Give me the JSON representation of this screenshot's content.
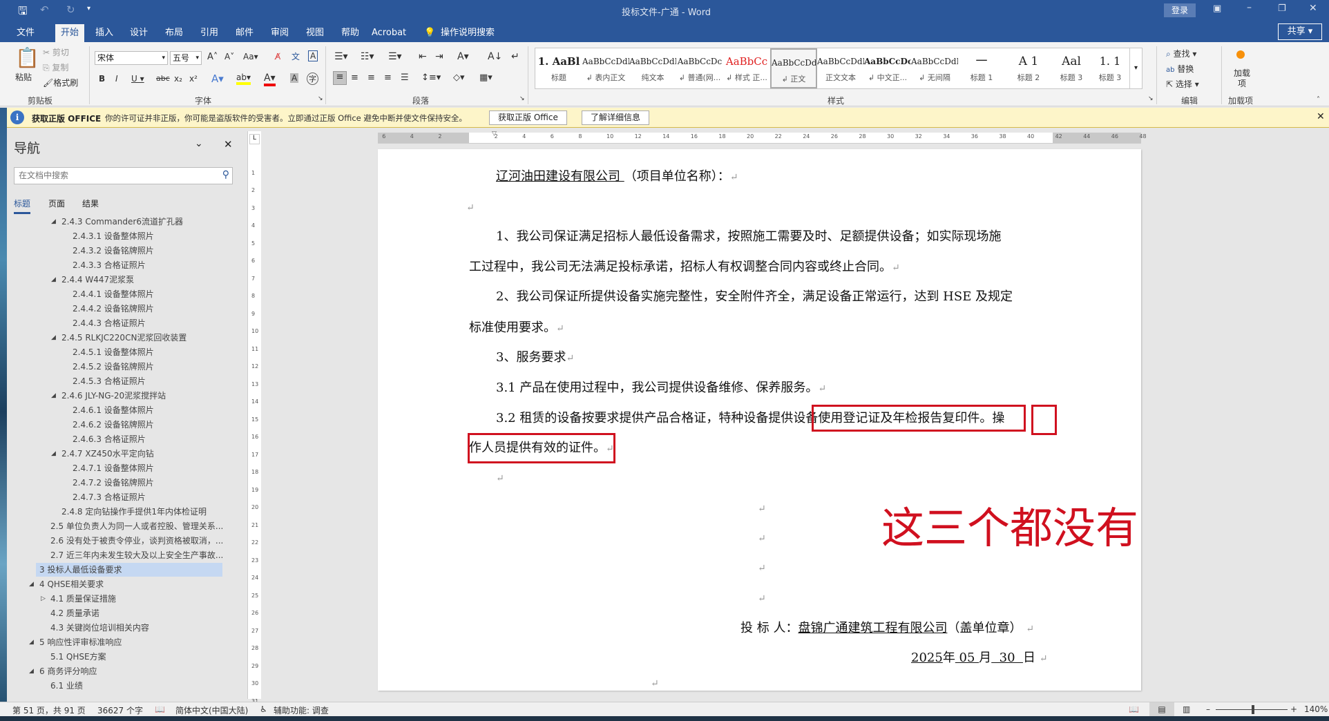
{
  "title": "投标文件-广通  -  Word",
  "qat": {
    "customize": "▾"
  },
  "window": {
    "login": "登录",
    "share": "共享"
  },
  "tabs": [
    "文件",
    "开始",
    "插入",
    "设计",
    "布局",
    "引用",
    "邮件",
    "审阅",
    "视图",
    "帮助",
    "Acrobat",
    "操作说明搜索"
  ],
  "ribbon": {
    "clipboard": {
      "paste": "粘贴",
      "cut": "剪切",
      "copy": "复制",
      "format_painter": "格式刷",
      "label": "剪贴板"
    },
    "font": {
      "name": "宋体",
      "size": "五号",
      "label": "字体"
    },
    "paragraph": {
      "label": "段落"
    },
    "styles": {
      "label": "样式",
      "items": [
        {
          "preview": "1. AaBl",
          "name": "标题"
        },
        {
          "preview": "AaBbCcDdI",
          "name": "↲ 表内正文"
        },
        {
          "preview": "AaBbCcDdI",
          "name": "纯文本"
        },
        {
          "preview": "AaBbCcDc",
          "name": "↲ 普通(网..."
        },
        {
          "preview": "AaBbCc",
          "name": "↲ 样式 正..."
        },
        {
          "preview": "AaBbCcDdI",
          "name": "↲ 正文"
        },
        {
          "preview": "AaBbCcDdI",
          "name": "正文文本"
        },
        {
          "preview": "AaBbCcDc",
          "name": "↲ 中文正..."
        },
        {
          "preview": "AaBbCcDdI",
          "name": "↲ 无间隔"
        },
        {
          "preview": "一",
          "name": "标题 1"
        },
        {
          "preview": "A  1",
          "name": "标题 2"
        },
        {
          "preview": "Aal",
          "name": "标题 3"
        },
        {
          "preview": "1. 1",
          "name": "标题 3"
        }
      ]
    },
    "editing": {
      "find": "查找",
      "replace": "替换",
      "select": "选择",
      "label": "编辑"
    },
    "addins": {
      "button": "加载项",
      "label": "加载项"
    }
  },
  "message_bar": {
    "title": "获取正版 OFFICE",
    "text": "你的许可证并非正版，你可能是盗版软件的受害者。立即通过正版 Office 避免中断并使文件保持安全。",
    "btn1": "获取正版 Office",
    "btn2": "了解详细信息"
  },
  "nav": {
    "title": "导航",
    "search_placeholder": "在文档中搜索",
    "tabs": [
      "标题",
      "页面",
      "结果"
    ],
    "items": [
      {
        "text": "2.4.3 Commander6流道扩孔器",
        "level": 3,
        "toggle": "◢"
      },
      {
        "text": "2.4.3.1 设备整体照片",
        "level": 4
      },
      {
        "text": "2.4.3.2 设备铭牌照片",
        "level": 4
      },
      {
        "text": "2.4.3.3 合格证照片",
        "level": 4
      },
      {
        "text": "2.4.4 W447泥浆泵",
        "level": 3,
        "toggle": "◢"
      },
      {
        "text": "2.4.4.1 设备整体照片",
        "level": 4
      },
      {
        "text": "2.4.4.2 设备铭牌照片",
        "level": 4
      },
      {
        "text": "2.4.4.3 合格证照片",
        "level": 4
      },
      {
        "text": "2.4.5 RLKJC220CN泥浆回收装置",
        "level": 3,
        "toggle": "◢"
      },
      {
        "text": "2.4.5.1 设备整体照片",
        "level": 4
      },
      {
        "text": "2.4.5.2 设备铭牌照片",
        "level": 4
      },
      {
        "text": "2.4.5.3 合格证照片",
        "level": 4
      },
      {
        "text": "2.4.6 JLY-NG-20泥浆搅拌站",
        "level": 3,
        "toggle": "◢"
      },
      {
        "text": "2.4.6.1 设备整体照片",
        "level": 4
      },
      {
        "text": "2.4.6.2 设备铭牌照片",
        "level": 4
      },
      {
        "text": "2.4.6.3 合格证照片",
        "level": 4
      },
      {
        "text": "2.4.7 XZ450水平定向钻",
        "level": 3,
        "toggle": "◢"
      },
      {
        "text": "2.4.7.1 设备整体照片",
        "level": 4
      },
      {
        "text": "2.4.7.2 设备铭牌照片",
        "level": 4
      },
      {
        "text": "2.4.7.3 合格证照片",
        "level": 4
      },
      {
        "text": "2.4.8 定向钻操作手提供1年内体检证明",
        "level": 3
      },
      {
        "text": "2.5 单位负责人为同一人或者控股、管理关系...",
        "level": 2
      },
      {
        "text": "2.6 没有处于被责令停业，谈判资格被取消，...",
        "level": 2
      },
      {
        "text": "2.7 近三年内未发生较大及以上安全生产事故...",
        "level": 2
      },
      {
        "text": "3 投标人最低设备要求",
        "level": 1,
        "selected": true
      },
      {
        "text": "4 QHSE相关要求",
        "level": 1,
        "toggle": "◢"
      },
      {
        "text": "4.1 质量保证措施",
        "level": 2,
        "toggle": "▷"
      },
      {
        "text": "4.2 质量承诺",
        "level": 2
      },
      {
        "text": "4.3 关键岗位培训相关内容",
        "level": 2
      },
      {
        "text": "5 响应性评审标准响应",
        "level": 1,
        "toggle": "◢"
      },
      {
        "text": "5.1 QHSE方案",
        "level": 2
      },
      {
        "text": "6 商务评分响应",
        "level": 1,
        "toggle": "◢"
      },
      {
        "text": "6.1 业绩",
        "level": 2
      }
    ]
  },
  "doc": {
    "addressee": "辽河油田建设有限公司 ",
    "addressee_suffix": "（项目单位名称）：",
    "p1a": "1、我公司保证满足招标人最低设备需求，按照施工需要及时、足额提供设备；如实际现场施",
    "p1b": "工过程中，我公司无法满足投标承诺，招标人有权调整合同内容或终止合同。",
    "p2a": "2、我公司保证所提供设备实施完整性，安全附件齐全，满足设备正常运行，达到 HSE 及规定",
    "p2b": "标准使用要求。",
    "p3": "3、服务要求",
    "p31": "3.1 产品在使用过程中，我公司提供设备维修、保养服务。",
    "p32a": "3.2 租赁的设备按要求提供产品合格证，特种设备提供设备使用登记证及年检报告复印件。操",
    "p32b": "作人员提供有效的证件。",
    "bidder_label": "投 标 人：",
    "bidder": "盘锦广通建筑工程有限公司",
    "bidder_suffix": "（盖单位章）",
    "date_year": "2025",
    "date_y": "年",
    "date_month": " 05 ",
    "date_m": "月",
    "date_day": "  30  ",
    "date_d": "日",
    "pilcrow": "↵"
  },
  "annotation": {
    "text": "这三个都没有",
    "color": "#d0101f"
  },
  "status": {
    "page": "第 51 页，共 91 页",
    "words": "36627 个字",
    "language": "简体中文(中国大陆)",
    "accessibility": "辅助功能: 调查",
    "zoom": "140%"
  },
  "colors": {
    "brand": "#2b579a",
    "annotation": "#d0101f"
  }
}
